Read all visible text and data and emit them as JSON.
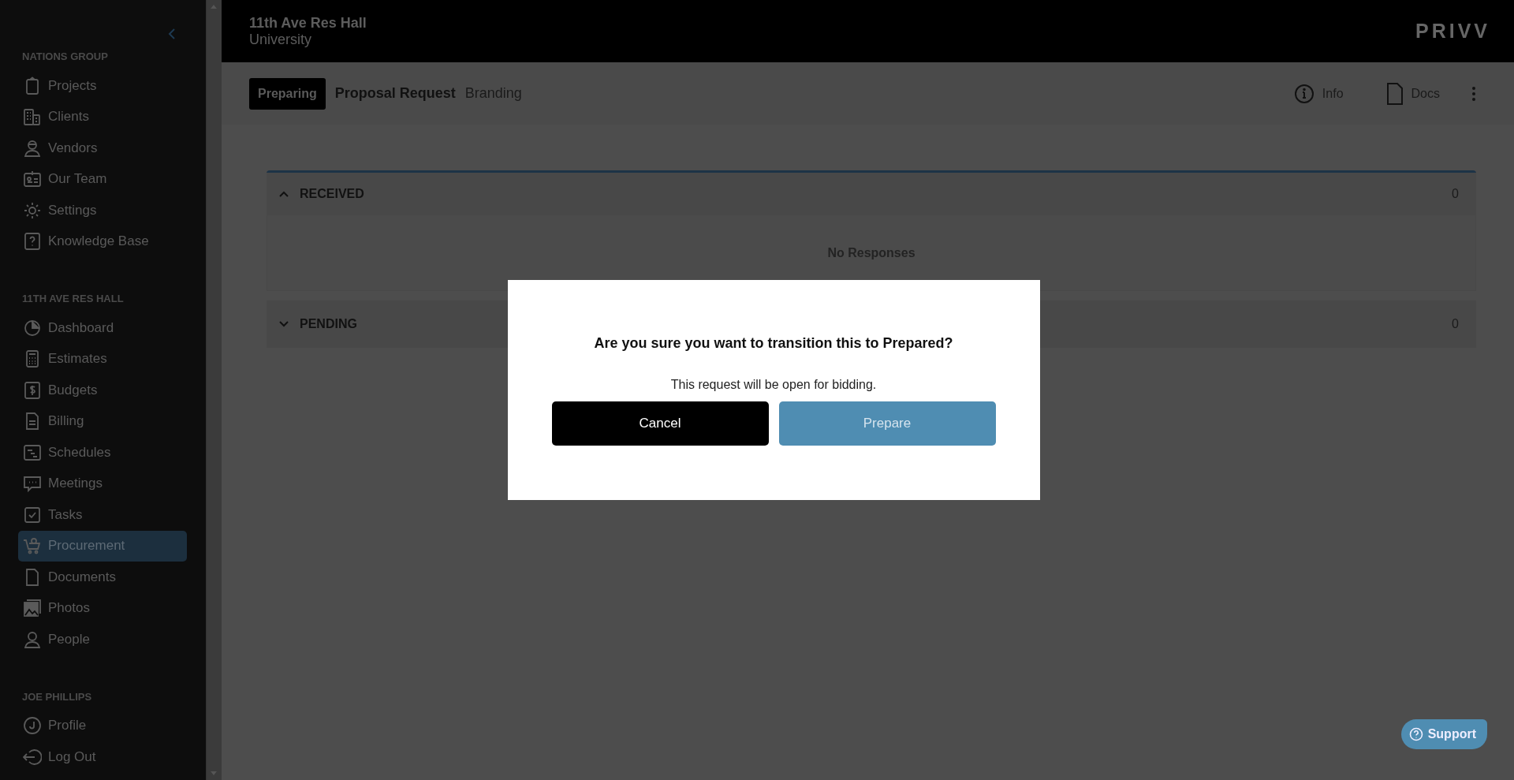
{
  "sidebar": {
    "sections": [
      {
        "heading": "NATIONS GROUP",
        "items": [
          {
            "label": "Projects",
            "selected": false
          },
          {
            "label": "Clients",
            "selected": false
          },
          {
            "label": "Vendors",
            "selected": false
          },
          {
            "label": "Our Team",
            "selected": false
          },
          {
            "label": "Settings",
            "selected": false
          },
          {
            "label": "Knowledge Base",
            "selected": false
          }
        ]
      },
      {
        "heading": "11TH AVE RES HALL",
        "items": [
          {
            "label": "Dashboard",
            "selected": false
          },
          {
            "label": "Estimates",
            "selected": false
          },
          {
            "label": "Budgets",
            "selected": false
          },
          {
            "label": "Billing",
            "selected": false
          },
          {
            "label": "Schedules",
            "selected": false
          },
          {
            "label": "Meetings",
            "selected": false
          },
          {
            "label": "Tasks",
            "selected": false
          },
          {
            "label": "Procurement",
            "selected": true
          },
          {
            "label": "Documents",
            "selected": false
          },
          {
            "label": "Photos",
            "selected": false
          },
          {
            "label": "People",
            "selected": false
          }
        ]
      },
      {
        "heading": "JOE PHILLIPS",
        "items": [
          {
            "label": "Profile",
            "selected": false
          },
          {
            "label": "Log Out",
            "selected": false
          }
        ]
      }
    ]
  },
  "header": {
    "project": "11th Ave Res Hall",
    "client": "University",
    "logo": "PRIVV"
  },
  "toolbar": {
    "status": "Preparing",
    "title": "Proposal Request",
    "subtitle": "Branding",
    "actions": [
      "Info",
      "Docs"
    ]
  },
  "panels": [
    {
      "title": "RECEIVED",
      "count": "0",
      "expanded": true,
      "empty_text": "No Responses"
    },
    {
      "title": "PENDING",
      "count": "0",
      "expanded": false
    }
  ],
  "dialog": {
    "title": "Are you sure you want to transition this to Prepared?",
    "message": "This request will be open for bidding.",
    "buttons": [
      "Cancel",
      "Prepare"
    ]
  },
  "support_button": "Support"
}
